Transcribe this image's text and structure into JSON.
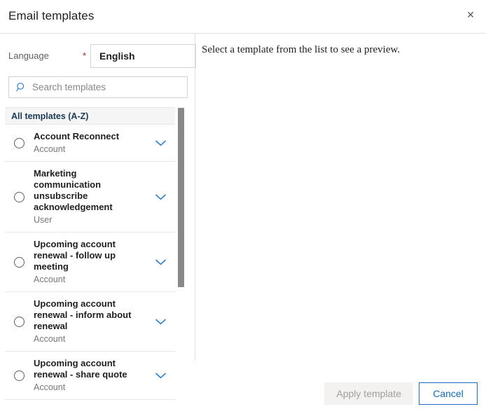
{
  "dialog": {
    "title": "Email templates",
    "close_icon": "close-icon",
    "close_label": "✕"
  },
  "form": {
    "language_label": "Language",
    "required_marker": "*",
    "language_value": "English"
  },
  "search": {
    "icon": "search-icon",
    "placeholder": "Search templates",
    "value": ""
  },
  "list": {
    "header": "All templates (A-Z)",
    "items": [
      {
        "name": "Account Reconnect",
        "entity": "Account",
        "selected": false,
        "expand_icon": "chevron-down-icon"
      },
      {
        "name": "Marketing communication unsubscribe acknowledgement",
        "entity": "User",
        "selected": false,
        "expand_icon": "chevron-down-icon"
      },
      {
        "name": "Upcoming account renewal - follow up meeting",
        "entity": "Account",
        "selected": false,
        "expand_icon": "chevron-down-icon"
      },
      {
        "name": "Upcoming account renewal - inform about renewal",
        "entity": "Account",
        "selected": false,
        "expand_icon": "chevron-down-icon"
      },
      {
        "name": "Upcoming account renewal - share quote",
        "entity": "Account",
        "selected": false,
        "expand_icon": "chevron-down-icon"
      }
    ]
  },
  "preview": {
    "placeholder": "Select a template from the list to see a preview."
  },
  "footer": {
    "apply_label": "Apply template",
    "apply_disabled": true,
    "cancel_label": "Cancel"
  },
  "colors": {
    "accent_blue": "#2b7cd3",
    "cancel_border": "#1b6ec2",
    "required_red": "#a4262c",
    "list_header_text": "#1b3a57",
    "divider": "#e1dfdd",
    "scrollbar_thumb": "#8a8886"
  }
}
